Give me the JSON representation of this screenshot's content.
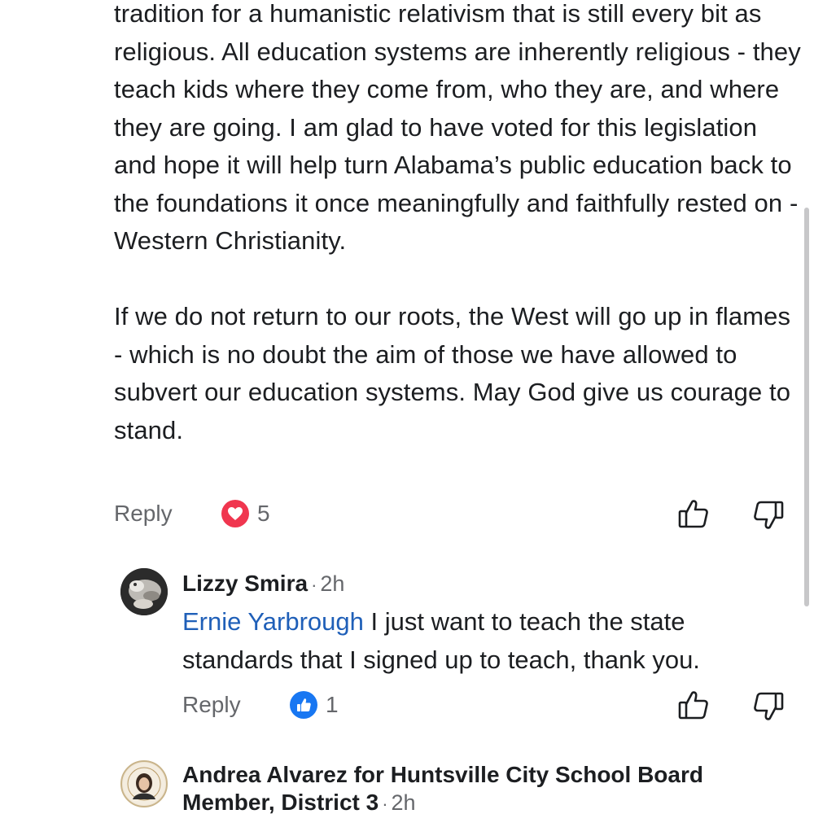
{
  "main_comment": {
    "paragraphs": [
      "tradition for a humanistic relativism that is still every bit as religious. All education systems are inherently religious - they teach kids where they come from, who they are, and where they are going. I am glad to have voted for this legislation and hope it will help turn Alabama’s public education back to the foundations it once meaningfully and faithfully rested on - Western Christianity.",
      "If we do not return to our roots, the West will go up in flames - which is no doubt the aim of those we have allowed to subvert our education systems. May God give us courage to stand."
    ],
    "reply_label": "Reply",
    "reaction_icon": "heart-icon",
    "reaction_count": "5"
  },
  "reply_1": {
    "author": "Lizzy Smira",
    "separator": "·",
    "time": "2h",
    "mention": "Ernie Yarbrough",
    "text": " I just want to teach the state standards that I signed up to teach, thank you.",
    "reply_label": "Reply",
    "reaction_icon": "like-icon",
    "reaction_count": "1"
  },
  "reply_2": {
    "author_line1": "Andrea Alvarez for Huntsville City School Board",
    "author_line2": "Member, District 3",
    "separator": "·",
    "time": "2h"
  },
  "colors": {
    "heart": "#f0364f",
    "like": "#1877f2",
    "mention": "#1f5fb8",
    "meta_gray": "#65676b"
  }
}
